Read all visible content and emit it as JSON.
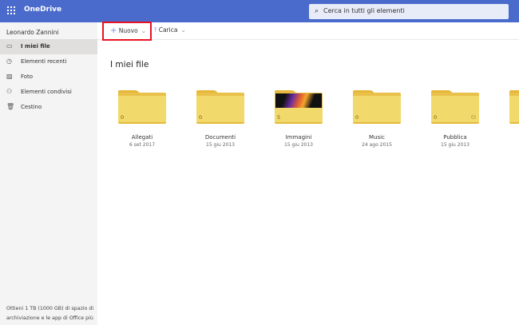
{
  "header": {
    "app_name": "OneDrive",
    "search_placeholder": "Cerca in tutti gli elementi"
  },
  "sidebar": {
    "user": "Leonardo Zannini",
    "items": [
      {
        "label": "I miei file",
        "icon": "folder-icon",
        "selected": true
      },
      {
        "label": "Elementi recenti",
        "icon": "history-icon"
      },
      {
        "label": "Foto",
        "icon": "photo-icon"
      },
      {
        "label": "Elementi condivisi",
        "icon": "people-icon"
      },
      {
        "label": "Cestino",
        "icon": "trash-icon"
      }
    ],
    "promo": "Ottieni 1 TB (1000 GB) di spazio di archiviazione e le app di Office più"
  },
  "toolbar": {
    "new_label": "Nuovo",
    "upload_label": "Carica"
  },
  "main": {
    "title": "I miei file",
    "folders": [
      {
        "name": "Allegati",
        "date": "6 set 2017",
        "count": "0"
      },
      {
        "name": "Documenti",
        "date": "15 giu 2013",
        "count": "0"
      },
      {
        "name": "Immagini",
        "date": "15 giu 2013",
        "count": "5"
      },
      {
        "name": "Music",
        "date": "24 ago 2015",
        "count": "0"
      },
      {
        "name": "Pubblica",
        "date": "15 giu 2013",
        "count": "0",
        "shared": true
      }
    ]
  },
  "colors": {
    "header": "#4a6bcc",
    "highlight": "#e81123",
    "folder": "#f2d96b"
  }
}
